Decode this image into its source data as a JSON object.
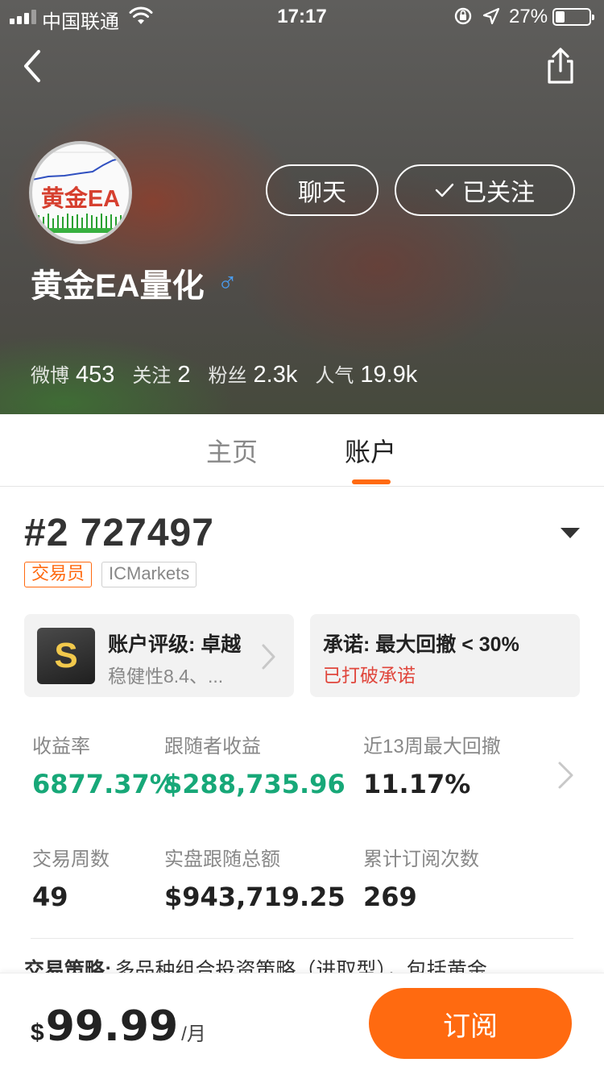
{
  "status_bar": {
    "carrier": "中国联通",
    "time": "17:17",
    "battery_text": "27%",
    "battery_level": 0.27
  },
  "profile": {
    "avatar_text": "黄金EA",
    "name": "黄金EA量化",
    "gender_symbol": "♂",
    "chat_label": "聊天",
    "follow_label": "已关注",
    "stats": [
      {
        "label": "微博",
        "value": "453"
      },
      {
        "label": "关注",
        "value": "2"
      },
      {
        "label": "粉丝",
        "value": "2.3k"
      },
      {
        "label": "人气",
        "value": "19.9k"
      }
    ]
  },
  "tabs": [
    {
      "label": "主页",
      "active": false
    },
    {
      "label": "账户",
      "active": true
    }
  ],
  "account": {
    "title": "#2 727497",
    "tag_role": "交易员",
    "tag_broker": "ICMarkets",
    "rating": {
      "badge": "S",
      "title": "账户评级: 卓越",
      "sub": "稳健性8.4、..."
    },
    "promise": {
      "title": "承诺: 最大回撤 < 30%",
      "status": "已打破承诺"
    },
    "metrics": [
      {
        "label": "收益率",
        "value": "6877.37%"
      },
      {
        "label": "跟随者收益",
        "value": "$288,735.96"
      },
      {
        "label": "近13周最大回撤",
        "value": "11.17%"
      },
      {
        "label": "交易周数",
        "value": "49"
      },
      {
        "label": "实盘跟随总额",
        "value": "$943,719.25"
      },
      {
        "label": "累计订阅次数",
        "value": "269"
      }
    ],
    "strategy_head": "交易策略:",
    "strategy_body": "多品种组合投资策略（进取型），包括黄金"
  },
  "subscription": {
    "currency": "$",
    "price": "99.99",
    "period": "/月",
    "button_label": "订阅"
  },
  "colors": {
    "accent": "#ff6a10",
    "positive": "#17a878",
    "warning": "#e0463c",
    "gender": "#4a9ff5"
  }
}
